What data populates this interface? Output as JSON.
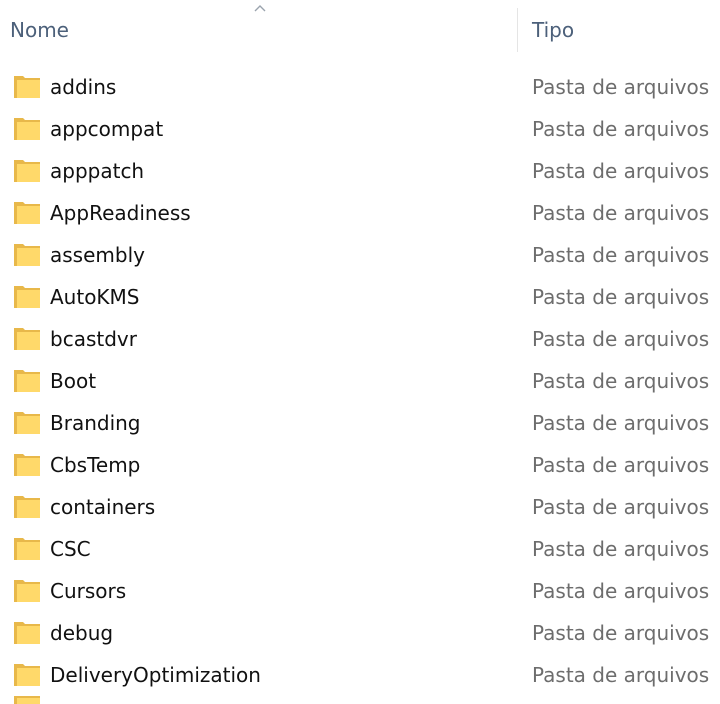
{
  "header": {
    "name_label": "Nome",
    "type_label": "Tipo",
    "sort_icon": "chevron-up-icon"
  },
  "colors": {
    "header_text": "#4c607a",
    "item_text": "#111111",
    "type_text": "#6d6d6d",
    "folder_back": "#e8b84a",
    "folder_front": "#ffd96a",
    "divider": "#e5e5e5"
  },
  "items": [
    {
      "name": "addins",
      "type": "Pasta de arquivos",
      "icon": "folder-icon"
    },
    {
      "name": "appcompat",
      "type": "Pasta de arquivos",
      "icon": "folder-icon"
    },
    {
      "name": "apppatch",
      "type": "Pasta de arquivos",
      "icon": "folder-icon"
    },
    {
      "name": "AppReadiness",
      "type": "Pasta de arquivos",
      "icon": "folder-icon"
    },
    {
      "name": "assembly",
      "type": "Pasta de arquivos",
      "icon": "folder-icon"
    },
    {
      "name": "AutoKMS",
      "type": "Pasta de arquivos",
      "icon": "folder-icon"
    },
    {
      "name": "bcastdvr",
      "type": "Pasta de arquivos",
      "icon": "folder-icon"
    },
    {
      "name": "Boot",
      "type": "Pasta de arquivos",
      "icon": "folder-icon"
    },
    {
      "name": "Branding",
      "type": "Pasta de arquivos",
      "icon": "folder-icon"
    },
    {
      "name": "CbsTemp",
      "type": "Pasta de arquivos",
      "icon": "folder-icon"
    },
    {
      "name": "containers",
      "type": "Pasta de arquivos",
      "icon": "folder-icon"
    },
    {
      "name": "CSC",
      "type": "Pasta de arquivos",
      "icon": "folder-icon"
    },
    {
      "name": "Cursors",
      "type": "Pasta de arquivos",
      "icon": "folder-icon"
    },
    {
      "name": "debug",
      "type": "Pasta de arquivos",
      "icon": "folder-icon"
    },
    {
      "name": "DeliveryOptimization",
      "type": "Pasta de arquivos",
      "icon": "folder-icon"
    }
  ]
}
